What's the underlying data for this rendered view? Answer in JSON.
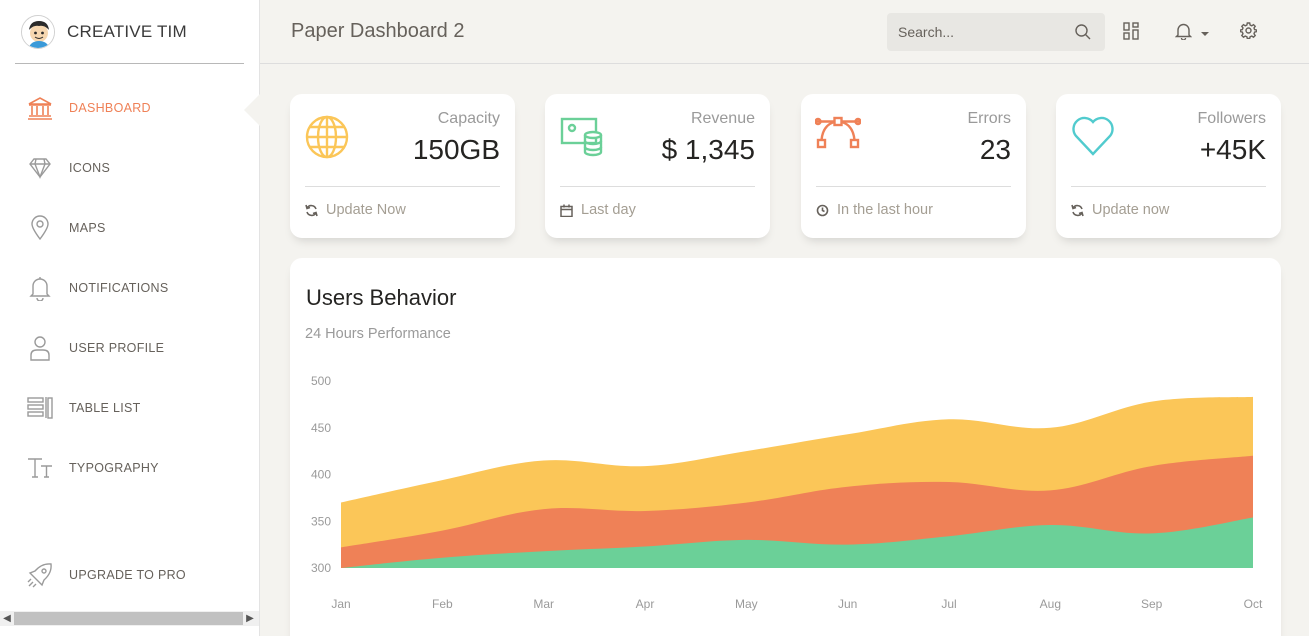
{
  "sidebar": {
    "brand": "CREATIVE TIM",
    "items": [
      {
        "label": "DASHBOARD",
        "icon": "bank-icon"
      },
      {
        "label": "ICONS",
        "icon": "diamond-icon"
      },
      {
        "label": "MAPS",
        "icon": "pin-icon"
      },
      {
        "label": "NOTIFICATIONS",
        "icon": "bell-icon"
      },
      {
        "label": "USER PROFILE",
        "icon": "user-icon"
      },
      {
        "label": "TABLE LIST",
        "icon": "table-icon"
      },
      {
        "label": "TYPOGRAPHY",
        "icon": "text-icon"
      }
    ],
    "active": "DASHBOARD",
    "upgrade": {
      "label": "UPGRADE TO PRO",
      "icon": "rocket-icon"
    }
  },
  "header": {
    "title": "Paper Dashboard 2",
    "search_placeholder": "Search..."
  },
  "colors": {
    "accent": "#ef8157",
    "warning": "#fbc658",
    "success": "#6bd098",
    "danger": "#ef8157",
    "info": "#51cbce"
  },
  "stats": [
    {
      "category": "Capacity",
      "value": "150GB",
      "footer": "Update Now",
      "icon": "globe-icon",
      "footer_icon": "refresh-icon",
      "color": "#fbc658"
    },
    {
      "category": "Revenue",
      "value": "$ 1,345",
      "footer": "Last day",
      "icon": "money-coins-icon",
      "footer_icon": "calendar-icon",
      "color": "#6bd098"
    },
    {
      "category": "Errors",
      "value": "23",
      "footer": "In the last hour",
      "icon": "vector-icon",
      "footer_icon": "clock-icon",
      "color": "#ef8157"
    },
    {
      "category": "Followers",
      "value": "+45K",
      "footer": "Update now",
      "icon": "heart-icon",
      "footer_icon": "refresh-icon",
      "color": "#51cbce"
    }
  ],
  "chart": {
    "title": "Users Behavior",
    "subtitle": "24 Hours Performance"
  },
  "chart_data": {
    "type": "area",
    "title": "Users Behavior",
    "subtitle": "24 Hours Performance",
    "categories": [
      "Jan",
      "Feb",
      "Mar",
      "Apr",
      "May",
      "Jun",
      "Jul",
      "Aug",
      "Sep",
      "Oct"
    ],
    "ylim": [
      300,
      500
    ],
    "yticks": [
      300,
      350,
      400,
      450,
      500
    ],
    "grid": false,
    "series": [
      {
        "color": "#fbc658",
        "values": [
          370,
          394,
          415,
          409,
          425,
          443,
          459,
          450,
          478,
          483
        ]
      },
      {
        "color": "#ef8157",
        "values": [
          322,
          340,
          363,
          361,
          370,
          387,
          392,
          383,
          409,
          420
        ]
      },
      {
        "color": "#6bd098",
        "values": [
          300,
          311,
          318,
          323,
          330,
          325,
          334,
          346,
          337,
          354
        ]
      }
    ]
  }
}
